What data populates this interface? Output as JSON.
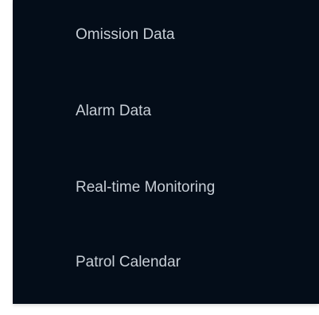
{
  "menu": {
    "items": [
      {
        "label": "Omission Data"
      },
      {
        "label": "Alarm Data"
      },
      {
        "label": "Real-time Monitoring"
      },
      {
        "label": "Patrol Calendar"
      }
    ]
  },
  "colors": {
    "panel_background": "#040d19",
    "label_text": "#c7ced6",
    "accent_yellow": "#f3b400",
    "accent_blue": "#1d79d6"
  }
}
